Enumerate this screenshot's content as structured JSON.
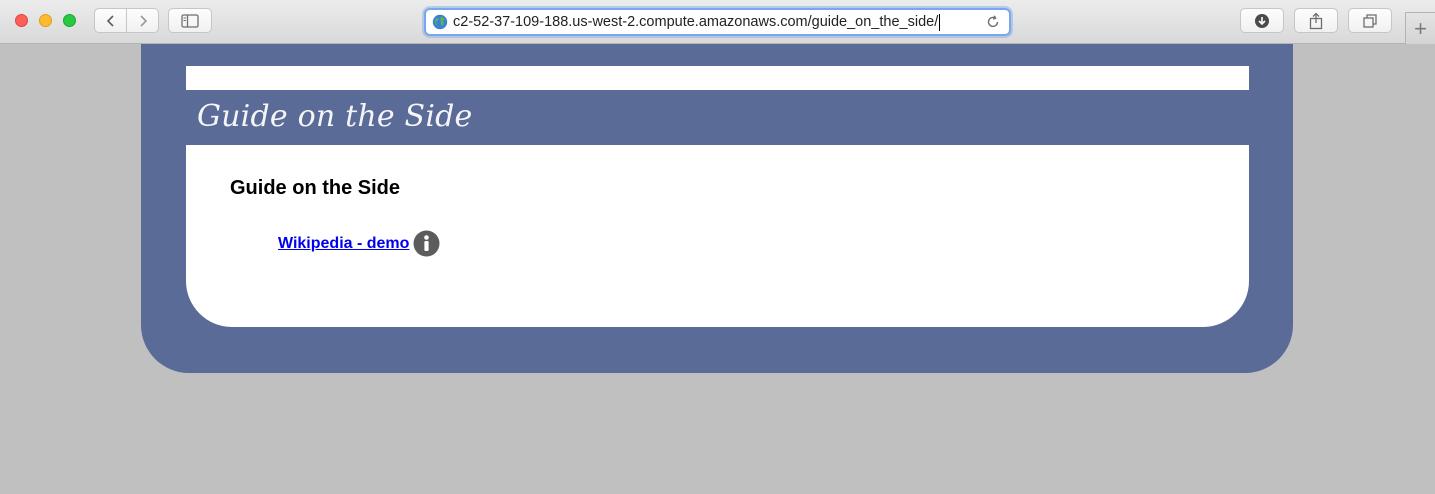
{
  "browser": {
    "url": "c2-52-37-109-188.us-west-2.compute.amazonaws.com/guide_on_the_side/",
    "new_tab_label": "+"
  },
  "site": {
    "title": "Guide on the Side"
  },
  "content": {
    "heading": "Guide on the Side",
    "guides": [
      {
        "label": "Wikipedia - demo"
      }
    ]
  },
  "colors": {
    "frame": "#5a6b97",
    "page_background": "#c0c0c0",
    "link": "#0000ee"
  }
}
